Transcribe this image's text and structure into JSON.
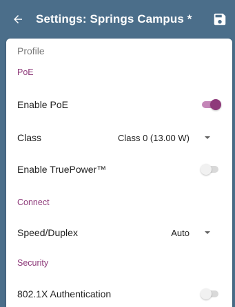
{
  "appbar": {
    "title": "Settings: Springs Campus *",
    "back_icon": "arrow-left-icon",
    "save_icon": "floppy-disk-icon",
    "background": "#4b6e8a"
  },
  "card": {
    "profile_label": "Profile",
    "sections": {
      "poe": {
        "header": "PoE",
        "enable_poe": {
          "label": "Enable PoE",
          "enabled": true
        },
        "class": {
          "label": "Class",
          "value": "Class 0 (13.00 W)"
        },
        "truepower": {
          "label": "Enable TruePower™",
          "enabled": false
        }
      },
      "connect": {
        "header": "Connect",
        "speed_duplex": {
          "label": "Speed/Duplex",
          "value": "Auto"
        }
      },
      "security": {
        "header": "Security",
        "auth": {
          "label": "802.1X Authentication",
          "enabled": false
        }
      }
    }
  },
  "colors": {
    "accent": "#8e3a7a",
    "accent_light": "#c486b8",
    "text": "#212121",
    "muted": "#7a7a7a"
  }
}
